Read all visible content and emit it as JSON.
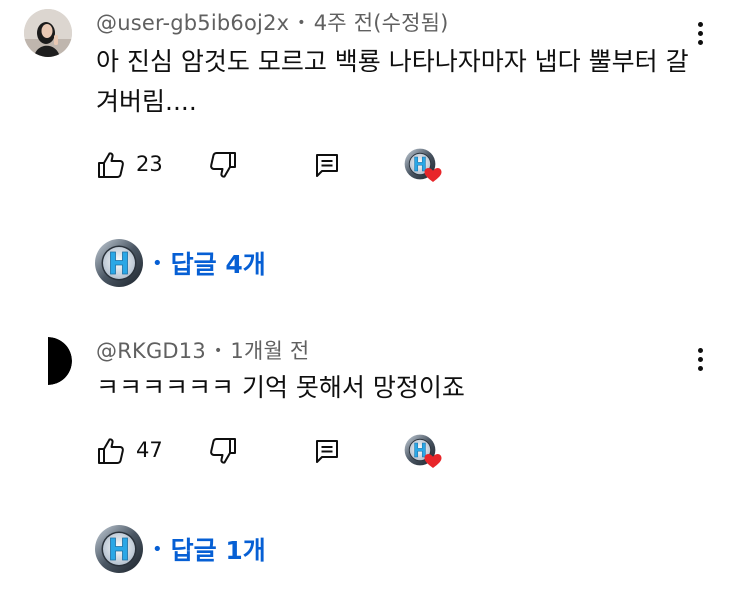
{
  "comments": [
    {
      "username": "@user-gb5ib6oj2x",
      "time": "4주 전(수정됨)",
      "text": "아 진심 암것도 모르고 백룡 나타나자마자 냅다 뿔부터 갈겨버림....",
      "likes": "23",
      "replies_label": "답글 4개"
    },
    {
      "username": "@RKGD13",
      "time": "1개월 전",
      "text": "ㅋㅋㅋㅋㅋㅋ 기억 못해서 망정이죠",
      "likes": "47",
      "replies_label": "답글 1개"
    }
  ],
  "icons": {
    "like": "thumbs-up-icon",
    "dislike": "thumbs-down-icon",
    "reply": "comment-icon",
    "more": "more-vert-icon",
    "heart": "creator-heart-icon"
  },
  "colors": {
    "link_blue": "#065fd4",
    "meta_gray": "#606060",
    "heart_red": "#e8262a",
    "text": "#0f0f0f"
  }
}
